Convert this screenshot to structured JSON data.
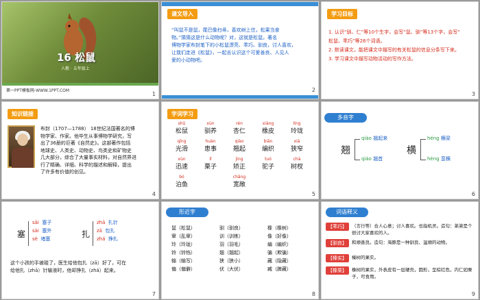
{
  "slides": {
    "s1": {
      "title": "16 松鼠",
      "subtitle": "人教 · 五年级上",
      "footer": "第一PPT模板网-WWW.1PPT.COM",
      "num": "1"
    },
    "s2": {
      "tag": "课文导入",
      "lines": [
        "“叫鼠不是鼠，尾巴像扫帚，喜欢树上住，松果当食",
        "物。”猜猜这是什么动物呢？对，这就是松鼠。著名",
        "博物学家布封笔下的小松鼠漂亮、乖巧、驯良，讨人喜欢，",
        "让我们走进《松鼠》，一起去认识这个可爱善良、人见人",
        "爱的小动物吧。"
      ],
      "num": "2"
    },
    "s3": {
      "tag": "学习目标",
      "lines": [
        "1. 认识“驯、仁”等10个生字，会写“鼠、驯”等13个字，会写“",
        "松鼠、乖巧”等26个词语。",
        "2. 默读课文，能把课文中描写的有关松鼠的信息分条写下来。",
        "3. 学习课文中描写动物活动的写作方法。"
      ],
      "num": "3"
    },
    "s4": {
      "tag": "知识链接",
      "lines": [
        "布封（1707—1788） 18世纪法国著名的博",
        "物学家、作家。他毕生从事博物学研究，写",
        "出了36册的巨著《自然史》。这部著作包括",
        "地球史、人类史、动物史、鸟类史和矿物史",
        "几大部分，综合了大量事实材料，对自然界进",
        "行了精确、详细、科学的描述和解释，提出",
        "了许多有价值的创见。"
      ],
      "num": "4"
    },
    "s5": {
      "tag": "字词学习",
      "rows": [
        [
          {
            "py": "shǔ",
            "hz": "松鼠"
          },
          {
            "py": "xùn",
            "hz": "驯养"
          },
          {
            "py": "rén",
            "hz": "杏仁"
          },
          {
            "py": "xiàng",
            "hz": "橡皮"
          },
          {
            "py": "líng",
            "hz": "玲珑"
          }
        ],
        [
          {
            "py": "qīng",
            "hz": "光滑"
          },
          {
            "py": "huàn",
            "hz": "患事"
          },
          {
            "py": "qiào",
            "hz": "翘起"
          },
          {
            "py": "biān",
            "hz": "编织"
          },
          {
            "py": "xiá",
            "hz": "狭窄"
          }
        ],
        [
          {
            "py": "xùn",
            "hz": "迅速"
          },
          {
            "py": "lǐ",
            "hz": "栗子"
          },
          {
            "py": "jìng",
            "hz": "矫正"
          },
          {
            "py": "tuó",
            "hz": "驼子"
          },
          {
            "py": "chà",
            "hz": "树杈"
          }
        ],
        [
          {
            "py": "bó",
            "hz": "泊鱼"
          },
          {
            "py": "",
            "hz": ""
          },
          {
            "py": "chǎng",
            "hz": "宽敞"
          },
          {
            "py": "",
            "hz": ""
          },
          {
            "py": "",
            "hz": ""
          }
        ]
      ],
      "num": "5"
    },
    "s6": {
      "tag": "多音字",
      "groups": [
        {
          "char": "翘",
          "items": [
            {
              "py": "qiào",
              "word": "翘起来"
            },
            {
              "py": "qiáo",
              "word": "翘首"
            }
          ]
        },
        {
          "char": "横",
          "items": [
            {
              "py": "héng",
              "word": "横梁"
            },
            {
              "py": "hèng",
              "word": "蛮横"
            }
          ]
        }
      ],
      "num": "6"
    },
    "s7": {
      "char1": "塞",
      "items1": [
        {
          "py": "sāi",
          "word": "塞子"
        },
        {
          "py": "sài",
          "word": "塞外"
        },
        {
          "py": "sè",
          "word": "堵塞"
        }
      ],
      "char2": "扎",
      "items2": [
        {
          "py": "zhā",
          "word": "扎针"
        },
        {
          "py": "zā",
          "word": "包扎"
        },
        {
          "py": "zhá",
          "word": "挣扎"
        }
      ],
      "sentence1": "这个小孩的手被碰了，医生给他包扎（zā）好了，可在",
      "sentence2": "给他扎（zhā）针输液时，他却挣扎（zhá）起来。",
      "num": "7"
    },
    "s8": {
      "tag": "形近字",
      "col1": [
        "鼠（松鼠）",
        "窜（乱窜）",
        "玲（玲珑）",
        "铃（铃铛）",
        "输（输写）",
        "偏（偏僻）"
      ],
      "col2": [
        "驯（驯良）",
        "训（训练）",
        "羽（羽毛）",
        "翘（翘起）",
        "狭（狭小）",
        "伏（大伏）"
      ],
      "col3": [
        "橡（橡树）",
        "像（好像）",
        "编（编织）",
        "骗（欺骗）",
        "藏（隐藏）",
        "臧（脾藏）"
      ],
      "num": "8"
    },
    "s9": {
      "tag": "词语释义",
      "terms": [
        {
          "term": "【乖巧】",
          "def": "（言行等）合人心意；讨人喜欢。也指机灵。造句：弟弟是个很讨大家喜欢的人。"
        },
        {
          "term": "【驯良】",
          "def": "和顺善良。造句：海豚是一种驯良、温顺的动物。"
        },
        {
          "term": "【榛实】",
          "def": "榛树的果实。"
        },
        {
          "term": "【橡栗】",
          "def": "橡树的果实，外表皮有一层硬壳，圆形，呈棕红色，内仁如栗子，可食用。"
        }
      ],
      "num": "9"
    }
  },
  "colors": {
    "accent": "#f39c12",
    "blue": "#2f7fd0",
    "red": "#d42a1a"
  }
}
